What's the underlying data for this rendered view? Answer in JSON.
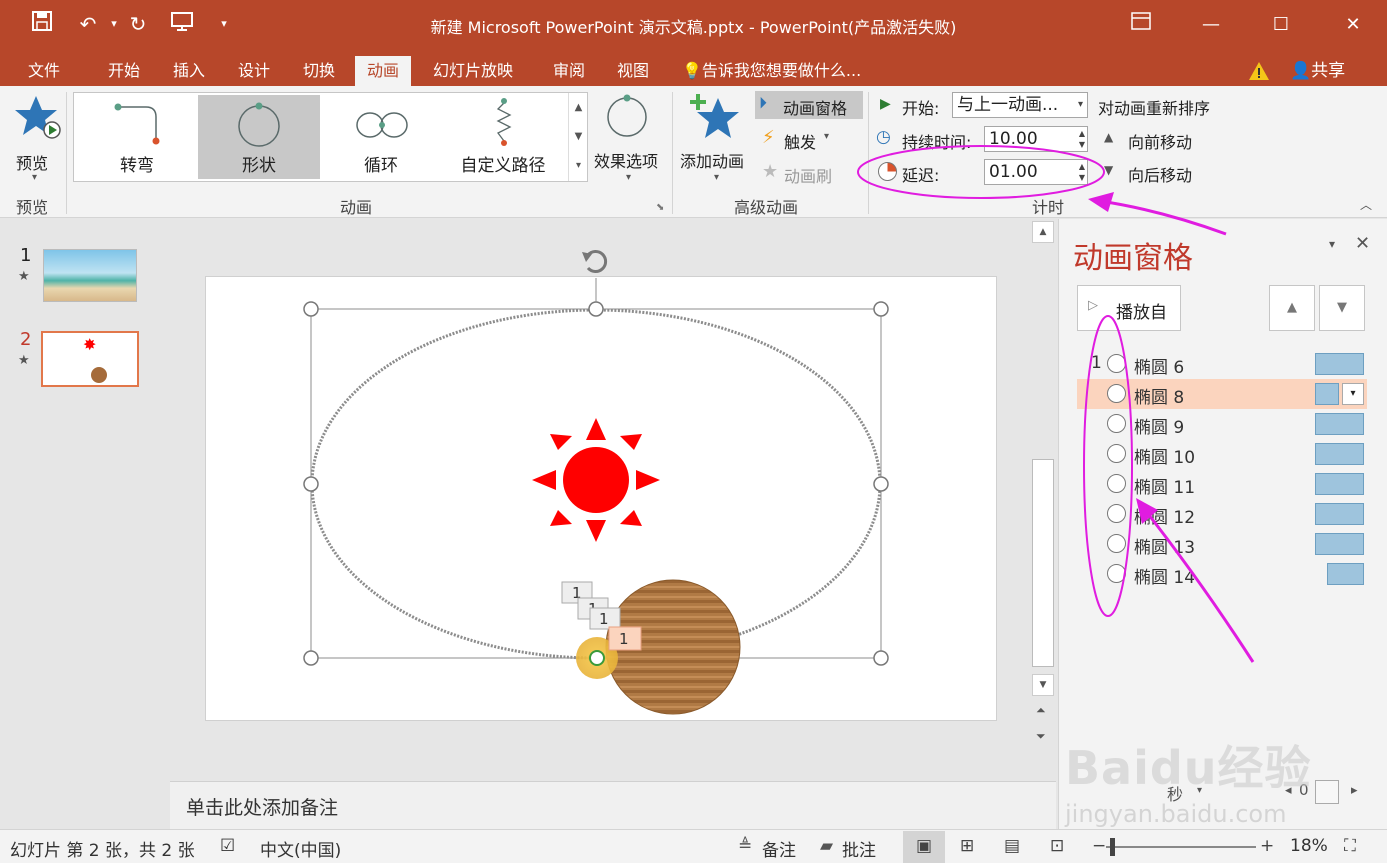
{
  "window": {
    "title": "新建 Microsoft PowerPoint 演示文稿.pptx - PowerPoint(产品激活失败)"
  },
  "tabs": [
    "文件",
    "开始",
    "插入",
    "设计",
    "切换",
    "动画",
    "幻灯片放映",
    "审阅",
    "视图"
  ],
  "active_tab": "动画",
  "tell_me": "告诉我您想要做什么...",
  "share": "共享",
  "ribbon": {
    "preview": {
      "label": "预览",
      "group": "预览"
    },
    "animation_gallery": {
      "items": [
        "转弯",
        "形状",
        "循环",
        "自定义路径"
      ],
      "selected": "形状",
      "group": "动画"
    },
    "effect_options": "效果选项",
    "add_animation": "添加动画",
    "animation_pane_btn": "动画窗格",
    "trigger": "触发",
    "animation_painter": "动画刷",
    "advanced_group": "高级动画",
    "start_label": "开始:",
    "start_value": "与上一动画...",
    "duration_label": "持续时间:",
    "duration_value": "10.00",
    "delay_label": "延迟:",
    "delay_value": "01.00",
    "timing_group": "计时",
    "reorder_title": "对动画重新排序",
    "move_earlier": "向前移动",
    "move_later": "向后移动"
  },
  "thumbnails": [
    {
      "number": "1"
    },
    {
      "number": "2"
    }
  ],
  "slide_tags": [
    "1",
    "1",
    "1",
    "1"
  ],
  "notes_placeholder": "单击此处添加备注",
  "anim_pane": {
    "title": "动画窗格",
    "play_from": "播放自",
    "items": [
      {
        "num": "1",
        "name": "椭圆 6"
      },
      {
        "num": "",
        "name": "椭圆 8"
      },
      {
        "num": "",
        "name": "椭圆 9"
      },
      {
        "num": "",
        "name": "椭圆 10"
      },
      {
        "num": "",
        "name": "椭圆 11"
      },
      {
        "num": "",
        "name": "椭圆 12"
      },
      {
        "num": "",
        "name": "椭圆 13"
      },
      {
        "num": "",
        "name": "椭圆 14"
      }
    ],
    "selected_index": 1,
    "seconds_label": "秒",
    "timeline_zero": "0"
  },
  "status": {
    "slide_info": "幻灯片 第 2 张，共 2 张",
    "language": "中文(中国)",
    "notes": "备注",
    "comments": "批注",
    "zoom": "18%"
  },
  "watermark": {
    "main": "Baidu经验",
    "sub": "jingyan.baidu.com"
  },
  "colors": {
    "accent": "#b7472a",
    "annotation": "#e01ce0",
    "bar": "#9ec4dd",
    "sun": "#ff0000"
  }
}
